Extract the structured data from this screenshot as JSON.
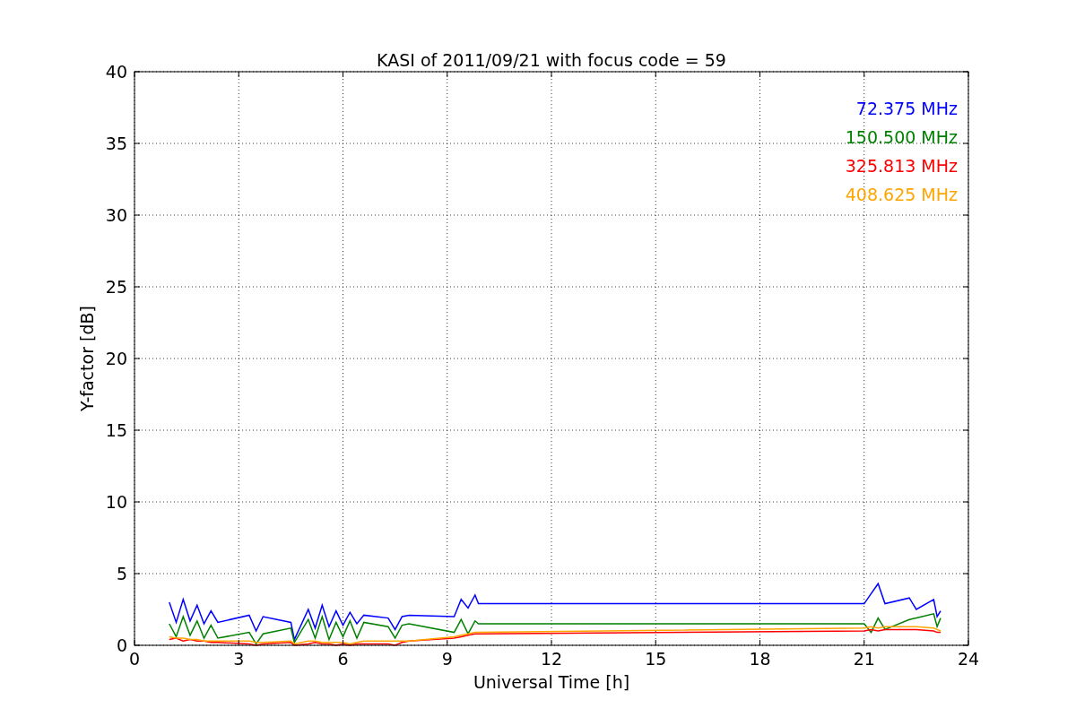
{
  "chart": {
    "chart_data": {
      "type": "line",
      "title": "KASI of 2011/09/21 with focus code = 59",
      "xlabel": "Universal Time [h]",
      "ylabel": "Y-factor [dB]",
      "x": [
        1.0,
        1.2,
        1.4,
        1.6,
        1.8,
        2.0,
        2.2,
        2.4,
        3.3,
        3.5,
        3.7,
        4.5,
        4.6,
        5.0,
        5.2,
        5.4,
        5.6,
        5.8,
        6.0,
        6.2,
        6.4,
        6.6,
        7.3,
        7.5,
        7.7,
        7.9,
        9.2,
        9.4,
        9.6,
        9.8,
        9.9,
        21.0,
        21.2,
        21.4,
        21.6,
        22.3,
        22.5,
        23.0,
        23.1,
        23.2
      ],
      "series": [
        {
          "name": "72.375 MHz",
          "color": "#0000ff",
          "values": [
            3.0,
            1.6,
            3.2,
            1.7,
            2.8,
            1.5,
            2.4,
            1.6,
            2.1,
            1.0,
            2.0,
            1.6,
            0.4,
            2.5,
            1.2,
            2.8,
            1.3,
            2.4,
            1.4,
            2.3,
            1.5,
            2.1,
            1.9,
            1.1,
            2.0,
            2.1,
            2.0,
            3.2,
            2.6,
            3.5,
            2.9,
            2.9,
            3.6,
            4.3,
            2.9,
            3.3,
            2.5,
            3.2,
            2.0,
            2.4
          ]
        },
        {
          "name": "150.500 MHz",
          "color": "#008000",
          "values": [
            1.5,
            0.6,
            2.0,
            0.7,
            1.7,
            0.5,
            1.4,
            0.5,
            0.9,
            0.1,
            0.8,
            1.2,
            0.2,
            1.8,
            0.5,
            2.0,
            0.4,
            1.6,
            0.6,
            1.7,
            0.5,
            1.6,
            1.3,
            0.5,
            1.4,
            1.5,
            0.9,
            1.8,
            0.8,
            1.7,
            1.5,
            1.5,
            0.9,
            1.9,
            1.1,
            1.8,
            1.9,
            2.2,
            1.3,
            1.9
          ]
        },
        {
          "name": "325.813 MHz",
          "color": "#ff0000",
          "values": [
            0.4,
            0.5,
            0.3,
            0.4,
            0.3,
            0.3,
            0.2,
            0.2,
            0.1,
            0.0,
            0.1,
            0.2,
            0.0,
            0.1,
            0.2,
            0.1,
            0.1,
            0.0,
            0.1,
            0.0,
            0.1,
            0.1,
            0.1,
            0.0,
            0.2,
            0.3,
            0.5,
            0.6,
            0.7,
            0.8,
            0.8,
            1.0,
            1.1,
            1.0,
            1.1,
            1.1,
            1.1,
            1.0,
            0.9,
            0.9
          ]
        },
        {
          "name": "408.625 MHz",
          "color": "#ffa500",
          "values": [
            0.6,
            0.5,
            0.5,
            0.4,
            0.4,
            0.3,
            0.3,
            0.3,
            0.3,
            0.2,
            0.2,
            0.3,
            0.1,
            0.3,
            0.3,
            0.2,
            0.2,
            0.2,
            0.2,
            0.1,
            0.2,
            0.3,
            0.3,
            0.3,
            0.3,
            0.3,
            0.6,
            0.7,
            0.8,
            0.9,
            0.9,
            1.2,
            1.3,
            1.2,
            1.3,
            1.3,
            1.3,
            1.2,
            1.1,
            1.0
          ]
        }
      ],
      "xlim": [
        0,
        24
      ],
      "ylim": [
        0,
        40
      ],
      "xticks": [
        0,
        3,
        6,
        9,
        12,
        15,
        18,
        21,
        24
      ],
      "yticks": [
        0,
        5,
        10,
        15,
        20,
        25,
        30,
        35,
        40
      ],
      "grid": true
    }
  }
}
